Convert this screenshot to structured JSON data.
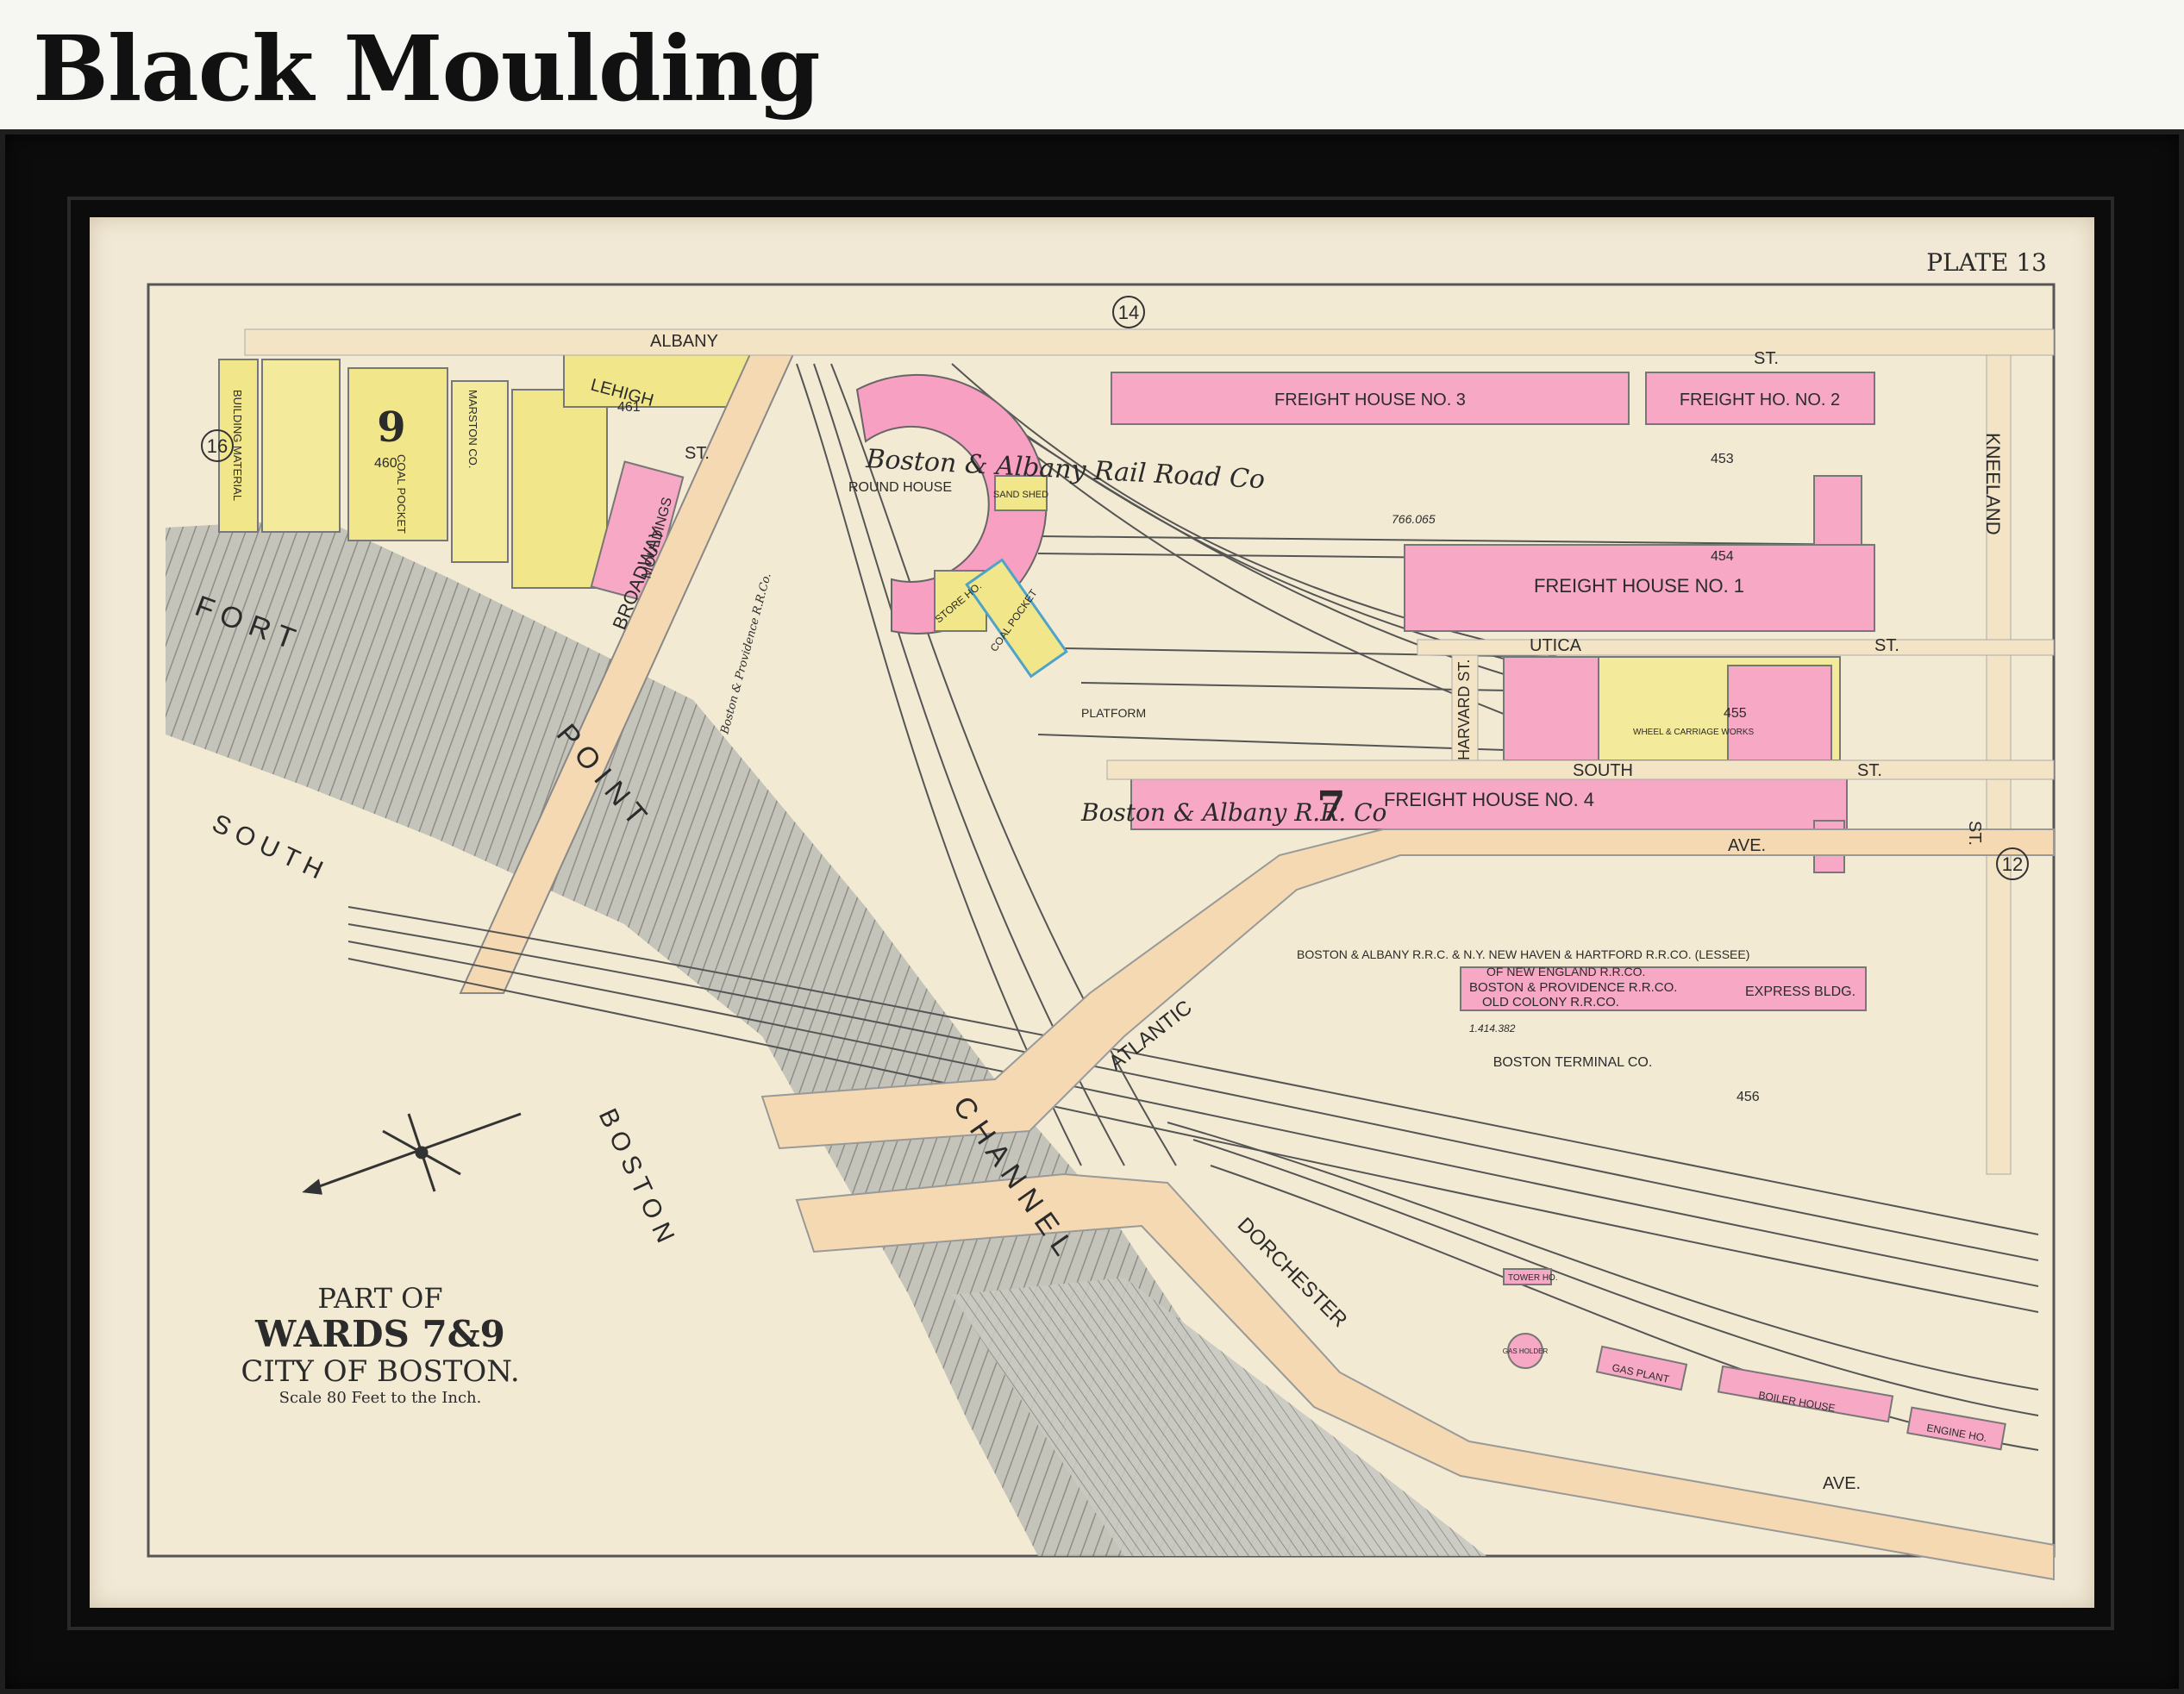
{
  "heading": "Black Moulding",
  "plate": "PLATE 13",
  "title_block": {
    "line1": "PART OF",
    "line2": "WARDS 7&9",
    "line3": "CITY OF BOSTON.",
    "scale": "Scale 80 Feet to the Inch."
  },
  "circles": [
    "14",
    "16",
    "12"
  ],
  "streets": {
    "albany": "ALBANY",
    "st1": "ST.",
    "lehigh": "LEHIGH",
    "st2": "ST.",
    "broadway": "BROADWAY",
    "kneeland": "KNEELAND",
    "utica": "UTICA",
    "st3": "ST.",
    "harvard": "HARVARD ST.",
    "south": "SOUTH",
    "st4": "ST.",
    "ave1": "AVE.",
    "st5": "ST.",
    "atlantic": "ATLANTIC",
    "dorchester": "DORCHESTER",
    "ave2": "AVE."
  },
  "water": {
    "fort": "F O R T",
    "point": "P O I N T",
    "channel": "C H A N N E L",
    "south": "S O U T H",
    "boston": "B O S T O N"
  },
  "buildings": {
    "fh3": "FREIGHT HOUSE NO. 3",
    "fh2": "FREIGHT HO. NO. 2",
    "fh1": "FREIGHT HOUSE NO. 1",
    "fh4": "FREIGHT HOUSE NO. 4",
    "roundhouse": "ROUND HOUSE",
    "sand": "SAND SHED",
    "store": "STORE HO.",
    "coal": "COAL POCKET",
    "coal2": "COAL POCKET",
    "platform": "PLATFORM",
    "mouldings": "MOULDINGS",
    "building_material": "BUILDING MATERIAL",
    "marston": "MARSTON CO.",
    "wheel": "WHEEL & CARRIAGE WORKS",
    "express": "EXPRESS BLDG.",
    "tower": "TOWER HO.",
    "gas_holder": "GAS HOLDER",
    "gas_plant": "GAS PLANT",
    "boiler": "BOILER HOUSE",
    "engine": "ENGINE HO."
  },
  "railroad_text": {
    "ba1": "Boston & Albany Rail Road Co",
    "ba2": "Boston & Albany R.R. Co",
    "lessee1": "BOSTON & ALBANY R.R.C. & N.Y. NEW HAVEN & HARTFORD R.R.CO. (LESSEE)",
    "lessee2": "OF NEW ENGLAND R.R.CO.",
    "bp": "BOSTON & PROVIDENCE R.R.CO.",
    "oc": "OLD COLONY R.R.CO.",
    "terminal": "BOSTON TERMINAL CO.",
    "bp_rr": "Boston & Providence R.R.Co."
  },
  "numbers": {
    "n453": "453",
    "n454": "454",
    "n455": "455",
    "n456": "456",
    "n460": "460",
    "n461": "461",
    "ward9": "9",
    "ward7": "7",
    "area1": "766.065",
    "area2": "1.414.382"
  }
}
